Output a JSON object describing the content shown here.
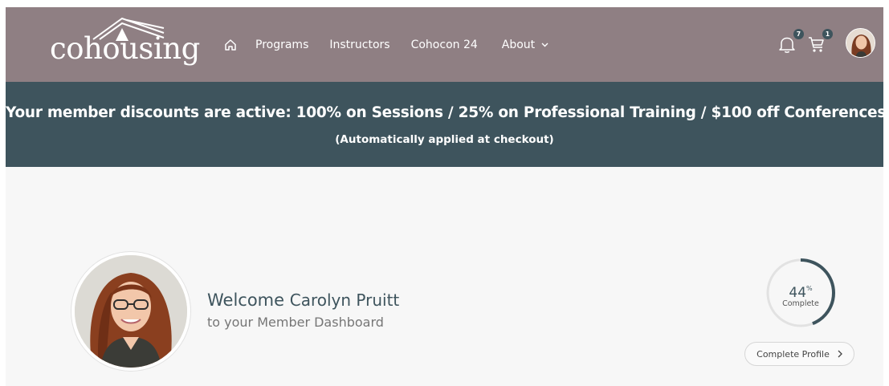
{
  "brand": {
    "logo_text": "cohousing",
    "colors": {
      "header": "#8f7f83",
      "banner": "#3e545d",
      "page": "#f7f7f7",
      "accent": "#3e545d"
    }
  },
  "nav": {
    "home_icon": "home-icon",
    "links": [
      "Programs",
      "Instructors",
      "Cohocon 24",
      "About"
    ]
  },
  "header_icons": {
    "notifications": {
      "icon": "bell-icon",
      "count": "7"
    },
    "cart": {
      "icon": "cart-icon",
      "count": "1"
    },
    "avatar": "user-avatar"
  },
  "banner": {
    "headline": "Your member discounts are active: 100% on Sessions / 25% on Professional Training / $100 off Conferences",
    "note": "(Automatically applied at checkout)"
  },
  "dashboard": {
    "greeting": "Welcome",
    "user_name": "Carolyn Pruitt",
    "subtitle": "to your Member Dashboard",
    "profile_progress": {
      "value": 44,
      "unit": "%",
      "label": "Complete"
    },
    "complete_profile_label": "Complete Profile"
  }
}
